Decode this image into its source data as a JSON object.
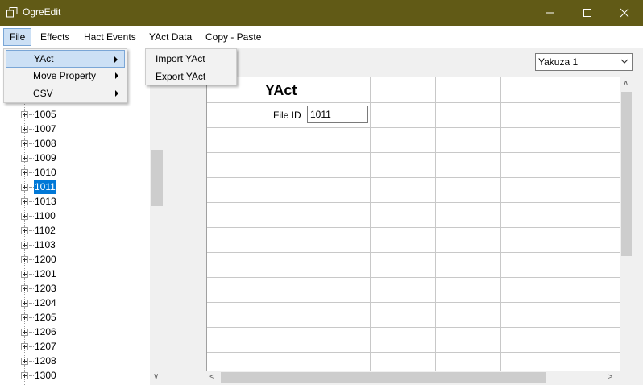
{
  "window": {
    "title": "OgreEdit",
    "minimize_icon": "minimize-icon",
    "maximize_icon": "maximize-icon",
    "close_icon": "close-icon"
  },
  "menubar": {
    "items": [
      "File",
      "Effects",
      "Hact Events",
      "YAct Data",
      "Copy - Paste"
    ],
    "active": "File"
  },
  "file_menu": {
    "items": [
      {
        "label": "YAct",
        "has_submenu": true,
        "highlighted": true
      },
      {
        "label": "Move Property",
        "has_submenu": true
      },
      {
        "label": "CSV",
        "has_submenu": true
      }
    ]
  },
  "yact_submenu": {
    "items": [
      "Import YAct",
      "Export YAct"
    ]
  },
  "tree": {
    "items": [
      "1005",
      "1007",
      "1008",
      "1009",
      "1010",
      "1011",
      "1013",
      "1100",
      "1102",
      "1103",
      "1200",
      "1201",
      "1203",
      "1204",
      "1205",
      "1206",
      "1207",
      "1208",
      "1300"
    ],
    "selected": "1011"
  },
  "game_select": {
    "value": "Yakuza 1"
  },
  "editor": {
    "section_title": "YAct",
    "file_id_label": "File ID",
    "file_id_value": "1011"
  },
  "colors": {
    "titlebar": "#615a16",
    "selection": "#0078d7",
    "menu_highlight": "#cce0f5"
  }
}
